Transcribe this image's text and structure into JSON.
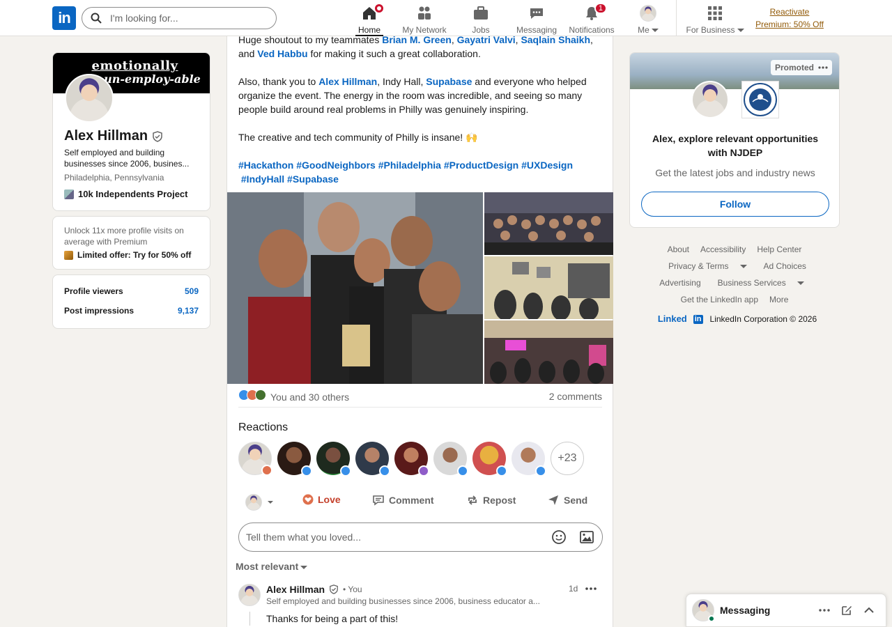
{
  "nav": {
    "search_placeholder": "I'm looking for...",
    "items": [
      {
        "label": "Home",
        "active": true
      },
      {
        "label": "My Network"
      },
      {
        "label": "Jobs"
      },
      {
        "label": "Messaging"
      },
      {
        "label": "Notifications",
        "badge": "1"
      },
      {
        "label": "Me"
      },
      {
        "label": "For Business"
      }
    ],
    "premium_line1": "Reactivate",
    "premium_line2": "Premium: 50% Off"
  },
  "profile": {
    "banner_line1": "emotionally",
    "banner_line2": "un-employ-able",
    "name": "Alex Hillman",
    "headline": "Self employed and building businesses since 2006, busines...",
    "location": "Philadelphia, Pennsylvania",
    "org": "10k Independents Project"
  },
  "premium_card": {
    "text": "Unlock 11x more profile visits on average with Premium",
    "offer": "Limited offer: Try for 50% off"
  },
  "stats": [
    {
      "label": "Profile viewers",
      "value": "509"
    },
    {
      "label": "Post impressions",
      "value": "9,137"
    }
  ],
  "post": {
    "line1_prefix": "Huge shoutout to my teammates ",
    "mentions1": [
      "Brian M. Green",
      "Gayatri Valvi",
      "Saqlain Shaikh"
    ],
    "line2_prefix": "and ",
    "mention_ved": "Ved Habbu",
    "line2_suffix": " for making it such a great collaboration.",
    "p2_prefix": "Also, thank you to ",
    "mention_alex": "Alex Hillman",
    "p2_mid": ", Indy Hall, ",
    "mention_supabase": "Supabase",
    "p2_suffix": " and everyone who helped organize the event. The energy in the room was incredible, and seeing so many people build around real problems in Philly was genuinely inspiring.",
    "p3": "The creative and tech community of Philly is insane! 🙌",
    "hashtags": [
      "#Hackathon",
      "#GoodNeighbors",
      "#Philadelphia",
      "#ProductDesign",
      "#UXDesign",
      "#IndyHall",
      "#Supabase"
    ],
    "reaction_summary": "You and 30 others",
    "comments_count": "2 comments",
    "reactions_title": "Reactions",
    "more_reactors": "+23",
    "actions": {
      "love": "Love",
      "comment": "Comment",
      "repost": "Repost",
      "send": "Send"
    },
    "comment_placeholder": "Tell them what you loved...",
    "sort": "Most relevant"
  },
  "comment": {
    "author": "Alex Hillman",
    "you": "• You",
    "headline": "Self employed and building businesses since 2006, business educator a...",
    "time": "1d",
    "text": "Thanks for being a part of this!"
  },
  "promo": {
    "promoted": "Promoted",
    "headline": "Alex, explore relevant opportunities with NJDEP",
    "sub": "Get the latest jobs and industry news",
    "follow": "Follow"
  },
  "footer": {
    "links": [
      "About",
      "Accessibility",
      "Help Center",
      "Privacy & Terms",
      "Ad Choices",
      "Advertising",
      "Business Services",
      "Get the LinkedIn app",
      "More"
    ],
    "copyright": "LinkedIn Corporation © 2026",
    "brand": "Linked",
    "brand_in": "in"
  },
  "messaging": {
    "title": "Messaging"
  },
  "colors": {
    "brand": "#0a66c2",
    "premium": "#915907",
    "badge": "#cb112d",
    "love": "#c4402b"
  }
}
